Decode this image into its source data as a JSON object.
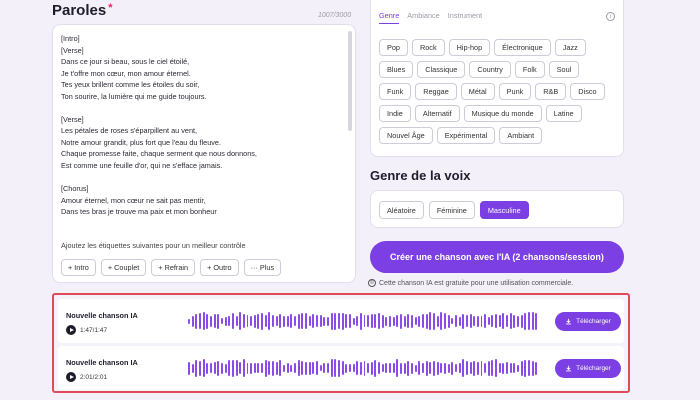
{
  "lyrics": {
    "title": "Paroles",
    "required_mark": "*",
    "char_count": "1007/3000",
    "text": "[Intro]\n[Verse]\nDans ce jour si beau, sous le ciel étoilé,\nJe t'offre mon cœur, mon amour éternel.\nTes yeux brillent comme les étoiles du soir,\nTon sourire, la lumière qui me guide toujours.\n\n[Verse]\nLes pétales de roses s'éparpillent au vent,\nNotre amour grandit, plus fort que l'eau du fleuve.\nChaque promesse faite, chaque serment que nous donnons,\nEst comme une feuille d'or, qui ne s'efface jamais.\n\n[Chorus]\nAmour éternel, mon cœur ne sait pas mentir,\nDans tes bras je trouve ma paix et mon bonheur",
    "tags_hint": "Ajoutez les étiquettes suivantes pour un meilleur contrôle",
    "tag_buttons": [
      {
        "prefix": "+",
        "label": "Intro"
      },
      {
        "prefix": "+",
        "label": "Couplet"
      },
      {
        "prefix": "+",
        "label": "Refrain"
      },
      {
        "prefix": "+",
        "label": "Outro"
      },
      {
        "prefix": "···",
        "label": "Plus"
      }
    ]
  },
  "style": {
    "tabs": [
      "Genre",
      "Ambiance",
      "Instrument"
    ],
    "active_tab": "Genre",
    "info_icon": "info-icon",
    "genres": [
      "Pop",
      "Rock",
      "Hip-hop",
      "Électronique",
      "Jazz",
      "Blues",
      "Classique",
      "Country",
      "Folk",
      "Soul",
      "Funk",
      "Reggae",
      "Métal",
      "Punk",
      "R&B",
      "Disco",
      "Indie",
      "Alternatif",
      "Musique du monde",
      "Latine",
      "Nouvel Âge",
      "Expérimental",
      "Ambiant"
    ]
  },
  "voice": {
    "title": "Genre de la voix",
    "options": [
      "Aléatoire",
      "Féminine",
      "Masculine"
    ],
    "selected": "Masculine"
  },
  "create_button": "Créer une chanson avec l'IA (2 chansons/session)",
  "notice": "Cette chanson IA est gratuite pour une utilisation commerciale.",
  "songs": [
    {
      "title": "Nouvelle chanson IA",
      "time": "1:47/1:47",
      "download": "Télécharger"
    },
    {
      "title": "Nouvelle chanson IA",
      "time": "2:01/2:01",
      "download": "Télécharger"
    }
  ],
  "colors": {
    "accent": "#7b3fe4",
    "highlight_frame": "#e04a5a",
    "background": "#f3f0f9"
  }
}
